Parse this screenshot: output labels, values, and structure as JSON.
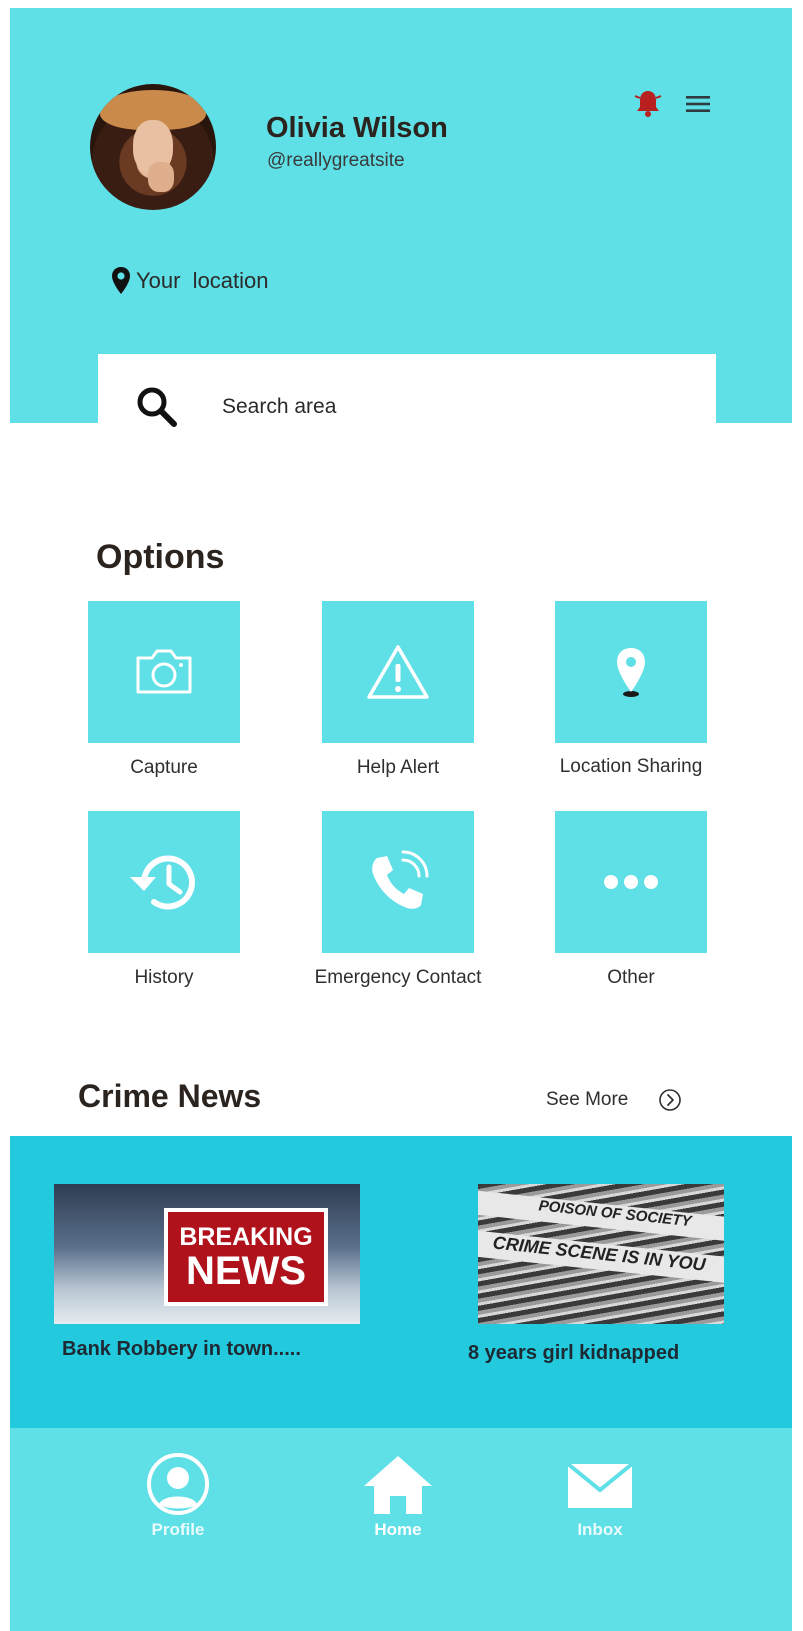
{
  "profile": {
    "name": "Olivia Wilson",
    "handle": "@reallygreatsite"
  },
  "location": {
    "label": "Your  location",
    "icon": "map-pin-icon"
  },
  "search": {
    "placeholder": "Search area",
    "icon": "search-icon"
  },
  "options": {
    "title": "Options",
    "items": [
      {
        "label": "Capture",
        "icon": "camera-icon"
      },
      {
        "label": "Help Alert",
        "icon": "warning-icon"
      },
      {
        "label": "Location Sharing",
        "icon": "location-pin-icon"
      },
      {
        "label": "History",
        "icon": "history-icon"
      },
      {
        "label": "Emergency Contact",
        "icon": "phone-call-icon"
      },
      {
        "label": "Other",
        "icon": "more-dots-icon"
      }
    ]
  },
  "news": {
    "title": "Crime News",
    "see_more": "See More",
    "items": [
      {
        "caption": "Bank Robbery in town.....",
        "image_text_1": "BREAKING",
        "image_text_2": "NEWS"
      },
      {
        "caption": "8 years girl kidnapped",
        "image_text_1": "POISON OF SOCIETY",
        "image_text_2": "CRIME SCENE IS IN YOU"
      }
    ]
  },
  "bottom_nav": {
    "items": [
      {
        "label": "Profile",
        "icon": "user-circle-icon"
      },
      {
        "label": "Home",
        "icon": "home-icon"
      },
      {
        "label": "Inbox",
        "icon": "mail-icon"
      }
    ]
  },
  "colors": {
    "accent": "#5fdfe6",
    "news_band": "#23c9dd",
    "bell": "#b8201f",
    "text_dark": "#2b231e"
  }
}
